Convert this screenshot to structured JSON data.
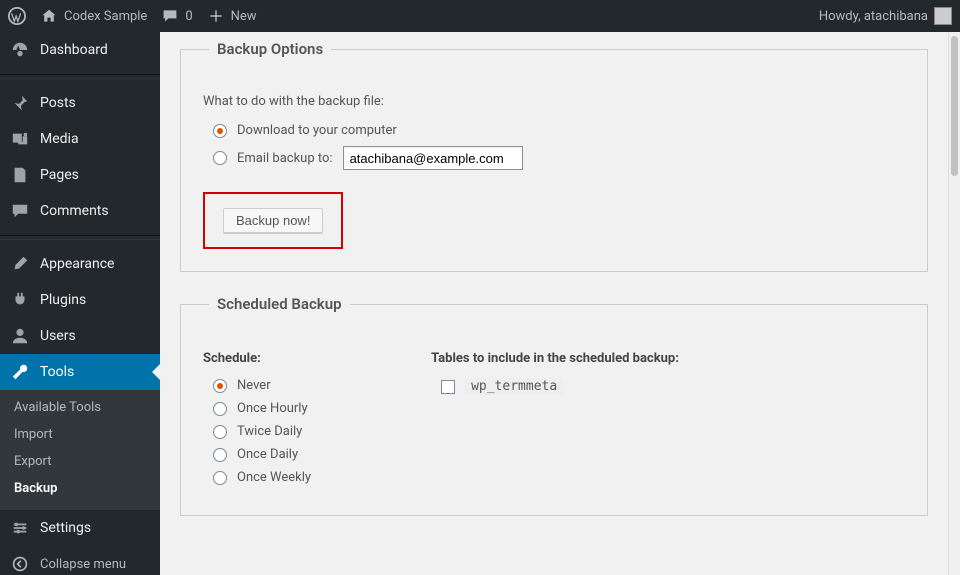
{
  "adminbar": {
    "site_name": "Codex Sample",
    "comments_count": "0",
    "new_label": "New",
    "greeting": "Howdy, atachibana"
  },
  "sidebar": {
    "items": [
      {
        "id": "dashboard",
        "label": "Dashboard"
      },
      {
        "id": "posts",
        "label": "Posts"
      },
      {
        "id": "media",
        "label": "Media"
      },
      {
        "id": "pages",
        "label": "Pages"
      },
      {
        "id": "comments",
        "label": "Comments"
      },
      {
        "id": "appearance",
        "label": "Appearance"
      },
      {
        "id": "plugins",
        "label": "Plugins"
      },
      {
        "id": "users",
        "label": "Users"
      },
      {
        "id": "tools",
        "label": "Tools"
      },
      {
        "id": "settings",
        "label": "Settings"
      }
    ],
    "tools_submenu": [
      {
        "label": "Available Tools"
      },
      {
        "label": "Import"
      },
      {
        "label": "Export"
      },
      {
        "label": "Backup"
      }
    ],
    "collapse_label": "Collapse menu"
  },
  "backup_options": {
    "legend": "Backup Options",
    "prompt": "What to do with the backup file:",
    "opt_download": "Download to your computer",
    "opt_email": "Email backup to:",
    "email_value": "atachibana@example.com",
    "button_label": "Backup now!"
  },
  "scheduled_backup": {
    "legend": "Scheduled Backup",
    "schedule_heading": "Schedule:",
    "schedule_options": [
      "Never",
      "Once Hourly",
      "Twice Daily",
      "Once Daily",
      "Once Weekly"
    ],
    "tables_heading": "Tables to include in the scheduled backup:",
    "tables": [
      "wp_termmeta"
    ]
  }
}
